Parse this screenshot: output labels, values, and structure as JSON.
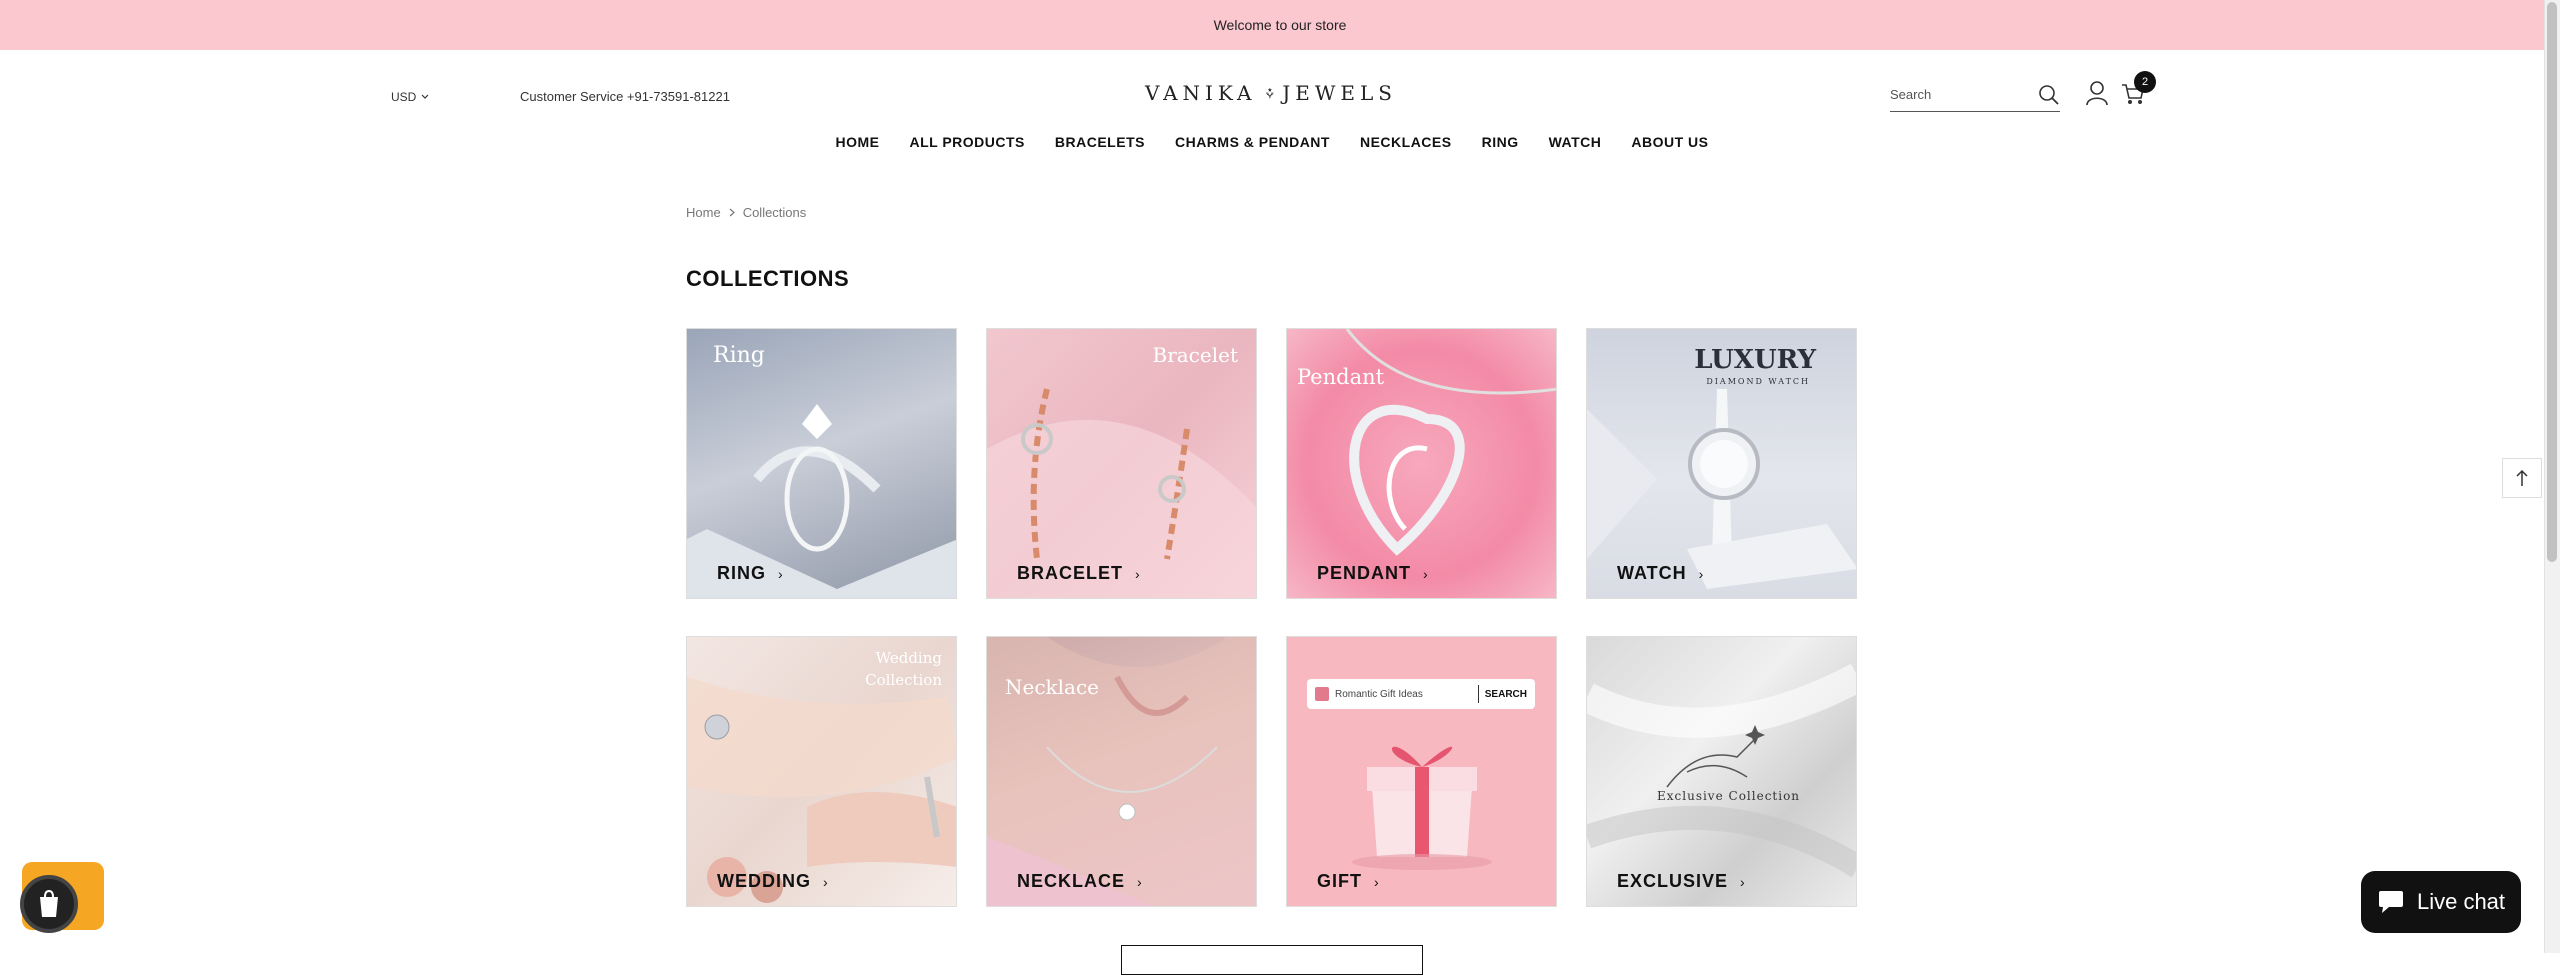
{
  "announcement": "Welcome to our store",
  "header": {
    "currency": "USD",
    "service": "Customer Service +91-73591-81221",
    "logo_left": "VANIKA",
    "logo_right": "JEWELS",
    "search_placeholder": "Search",
    "cart_count": "2"
  },
  "nav": [
    "HOME",
    "ALL PRODUCTS",
    "BRACELETS",
    "CHARMS & PENDANT",
    "NECKLACES",
    "RING",
    "WATCH",
    "ABOUT US"
  ],
  "breadcrumb": {
    "home": "Home",
    "current": "Collections"
  },
  "page_title": "COLLECTIONS",
  "tiles": [
    {
      "label": "RING",
      "photo_text": "Ring"
    },
    {
      "label": "BRACELET",
      "photo_text": "Bracelet"
    },
    {
      "label": "PENDANT",
      "photo_text": "Pendant"
    },
    {
      "label": "WATCH",
      "photo_text": "LUXURY",
      "photo_subtext": "DIAMOND WATCH"
    },
    {
      "label": "WEDDING",
      "photo_text": "Wedding",
      "photo_subtext": "Collection"
    },
    {
      "label": "NECKLACE",
      "photo_text": "Necklace"
    },
    {
      "label": "GIFT",
      "photo_text": "Romantic Gift Ideas",
      "photo_subtext": "SEARCH"
    },
    {
      "label": "EXCLUSIVE",
      "photo_text": "Exclusive Collection"
    }
  ],
  "live_chat": "Live chat",
  "colors": {
    "announce_bg": "#fcc8d0",
    "text": "#111111"
  }
}
